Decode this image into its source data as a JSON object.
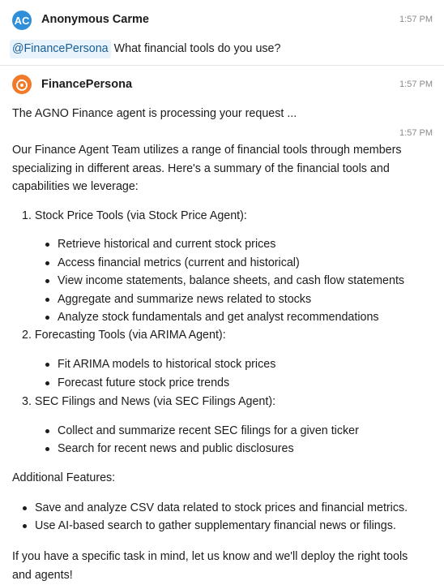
{
  "messages": [
    {
      "avatar_initials": "AC",
      "author": "Anonymous Carme",
      "time": "1:57 PM",
      "mention": "@FinancePersona",
      "text": "What financial tools do you use?"
    },
    {
      "avatar_icon": "finance-persona-logo-icon",
      "author": "FinancePersona",
      "time": "1:57 PM",
      "text": "The AGNO Finance agent is processing your request ..."
    },
    {
      "time": "1:57 PM",
      "intro": "Our Finance Agent Team utilizes a range of financial tools through members specializing in different areas. Here's a summary of the financial tools and capabilities we leverage:",
      "tools": [
        {
          "num": "1.",
          "title": "Stock Price Tools (via Stock Price Agent):",
          "items": [
            "Retrieve historical and current stock prices",
            "Access financial metrics (current and historical)",
            "View income statements, balance sheets, and cash flow statements",
            "Aggregate and summarize news related to stocks",
            "Analyze stock fundamentals and get analyst recommendations"
          ]
        },
        {
          "num": "2.",
          "title": "Forecasting Tools (via ARIMA Agent):",
          "items": [
            "Fit ARIMA models to historical stock prices",
            "Forecast future stock price trends"
          ]
        },
        {
          "num": "3.",
          "title": "SEC Filings and News (via SEC Filings Agent):",
          "items": [
            "Collect and summarize recent SEC filings for a given ticker",
            "Search for recent news and public disclosures"
          ]
        }
      ],
      "additional_title": "Additional Features:",
      "additional_items": [
        "Save and analyze CSV data related to stock prices and financial metrics.",
        "Use AI-based search to gather supplementary financial news or filings."
      ],
      "closing": "If you have a specific task in mind, let us know and we'll deploy the right tools and agents!"
    }
  ]
}
